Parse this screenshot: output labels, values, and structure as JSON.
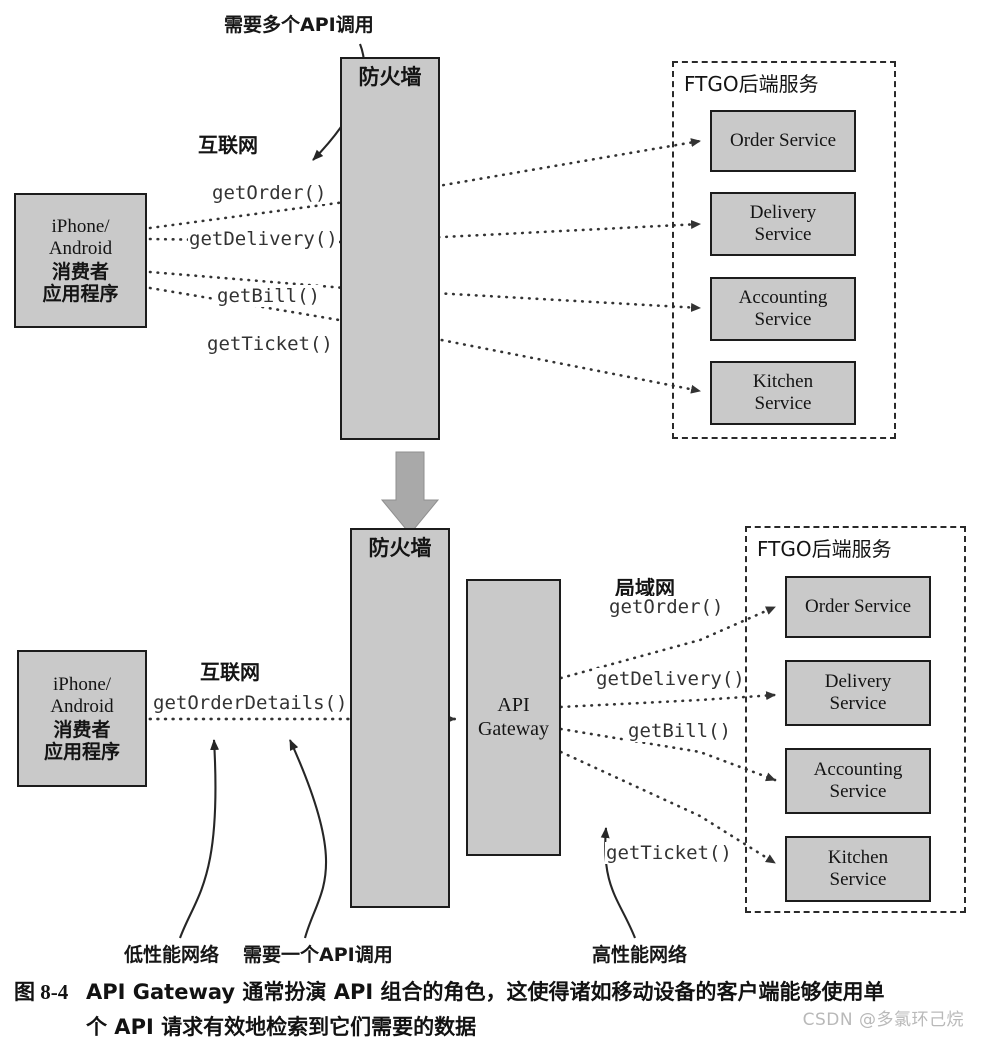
{
  "figure": {
    "caption_number": "图 8-4",
    "caption_line1": "API Gateway 通常扮演 API 组合的角色，这使得诸如移动设备的客户端能够使用单",
    "caption_line2": "个 API 请求有效地检索到它们需要的数据",
    "watermark": "CSDN @多氯环己烷",
    "colors": {
      "node_fill": "#c9c9c9",
      "node_border": "#1c1c1c",
      "dashed_border": "#2a2a2a",
      "arrow": "#333333",
      "big_arrow": "#a9a9a9",
      "watermark": "#b9b9b9",
      "background": "#ffffff"
    }
  },
  "top_diagram": {
    "annotation": "需要多个API调用",
    "network_label": "互联网",
    "client": {
      "line1": "iPhone/",
      "line2": "Android",
      "line3": "消费者",
      "line4": "应用程序"
    },
    "firewall": "防火墙",
    "backend_box_title": "FTGO后端服务",
    "calls": [
      "getOrder()",
      "getDelivery()",
      "getBill()",
      "getTicket()"
    ],
    "services": [
      {
        "line1": "Order Service",
        "line2": ""
      },
      {
        "line1": "Delivery",
        "line2": "Service"
      },
      {
        "line1": "Accounting",
        "line2": "Service"
      },
      {
        "line1": "Kitchen",
        "line2": "Service"
      }
    ]
  },
  "bottom_diagram": {
    "network_label_left": "互联网",
    "network_label_right": "局域网",
    "client": {
      "line1": "iPhone/",
      "line2": "Android",
      "line3": "消费者",
      "line4": "应用程序"
    },
    "client_call": "getOrderDetails()",
    "firewall": "防火墙",
    "gateway": {
      "line1": "API",
      "line2": "Gateway"
    },
    "backend_box_title": "FTGO后端服务",
    "calls": [
      "getOrder()",
      "getDelivery()",
      "getBill()",
      "getTicket()"
    ],
    "services": [
      {
        "line1": "Order Service",
        "line2": ""
      },
      {
        "line1": "Delivery",
        "line2": "Service"
      },
      {
        "line1": "Accounting",
        "line2": "Service"
      },
      {
        "line1": "Kitchen",
        "line2": "Service"
      }
    ],
    "annotations": {
      "low_perf": "低性能网络",
      "single_call": "需要一个API调用",
      "high_perf": "高性能网络"
    }
  }
}
